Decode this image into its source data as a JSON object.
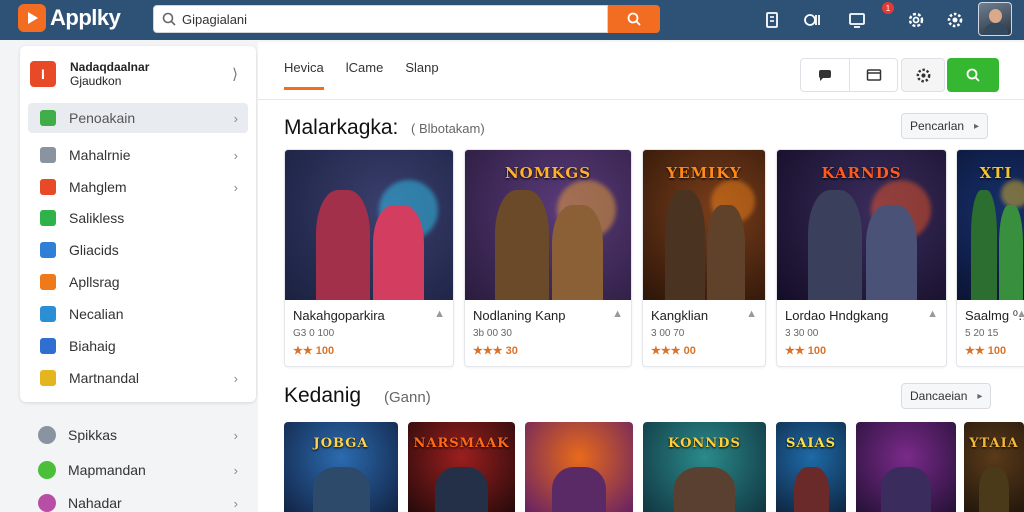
{
  "app": {
    "name": "Applky"
  },
  "search": {
    "value": "Gipagialani",
    "placeholder": ""
  },
  "header": {
    "notif_count": "1"
  },
  "sidebar": {
    "header": {
      "line1": "Nadaqdaalnar",
      "line2": "Gjaudkon",
      "icon_letter": "I"
    },
    "items": [
      {
        "label": "Penoakain",
        "icon_color": "#3fae49"
      },
      {
        "label": "Mahalrnie",
        "icon_color": "#8a94a0"
      },
      {
        "label": "Mahglem",
        "icon_color": "#e84a27"
      },
      {
        "label": "Salikless",
        "icon_color": "#2fb24a"
      },
      {
        "label": "Gliacids",
        "icon_color": "#2f7fd6"
      },
      {
        "label": "Apllsrag",
        "icon_color": "#f07a1a"
      },
      {
        "label": "Necalian",
        "icon_color": "#2b8fd6"
      },
      {
        "label": "Biahaig",
        "icon_color": "#2f6fd0"
      },
      {
        "label": "Martnandal",
        "icon_color": "#e3b61f"
      }
    ],
    "items2": [
      {
        "label": "Spikkas",
        "icon_color": "#8a94a0"
      },
      {
        "label": "Mapmandan",
        "icon_color": "#4cbf3a"
      },
      {
        "label": "Nahadar",
        "icon_color": "#b84fa7"
      }
    ]
  },
  "tabs": [
    {
      "label": "Hevica"
    },
    {
      "label": "lCame"
    },
    {
      "label": "Slanp"
    }
  ],
  "section1": {
    "title": "Malarkagka:",
    "subtitle": "( Blbotakam)",
    "button": "Pencarlan"
  },
  "section2": {
    "title": "Kedanig",
    "subtitle": "(Gann)",
    "button": "Dancaeian"
  },
  "cards": [
    {
      "name": "Nakahgoparkira",
      "meta": "G3 0 100",
      "price": "★★ 100",
      "banner": "",
      "bg1": "#3b3f6e",
      "bg2": "#1a2140",
      "accent": "#2fd7ff",
      "fig": "#a2304a"
    },
    {
      "name": "Nodlaning Kanp",
      "meta": "3b 00 30",
      "price": "★★★ 30",
      "banner": "NOMKGS",
      "bg1": "#5a3b7a",
      "bg2": "#2a1c3d",
      "accent": "#ffb02e",
      "fig": "#6b4a2a"
    },
    {
      "name": "Kangklian",
      "meta": "3 00 70",
      "price": "★★★ 00",
      "banner": "YEMIKY",
      "bg1": "#7a3e1b",
      "bg2": "#2c1508",
      "accent": "#ff8a1a",
      "fig": "#4a3320"
    },
    {
      "name": "Lordao Hndgkang",
      "meta": "3 30 00",
      "price": "★★ 100",
      "banner": "KARNDS",
      "bg1": "#3b2d5e",
      "bg2": "#140d26",
      "accent": "#ff5a1f",
      "fig": "#3a3f5c"
    },
    {
      "name": "Saalmg ⁰…",
      "meta": "5 20 15",
      "price": "★★ 100",
      "banner": "XTI",
      "bg1": "#16306b",
      "bg2": "#0b1434",
      "accent": "#f5c425",
      "fig": "#2b6e2f"
    }
  ],
  "cards2": [
    {
      "banner": "JOBGA",
      "bg1": "#2b6bb0",
      "bg2": "#101d3b",
      "accent": "#ffd34a",
      "fig": "#2d4a6b"
    },
    {
      "banner": "NARSMAAK",
      "bg1": "#9b1f1f",
      "bg2": "#1a0808",
      "accent": "#ff6a1a",
      "fig": "#243048"
    },
    {
      "banner": "",
      "bg1": "#e86a1a",
      "bg2": "#5a1a6b",
      "accent": "#ffd54a",
      "fig": "#5a2a66"
    },
    {
      "banner": "KONNDS",
      "bg1": "#2a8a8a",
      "bg2": "#0f2f3b",
      "accent": "#ffcf3a",
      "fig": "#5a4030"
    },
    {
      "banner": "SAIAS",
      "bg1": "#1e6aa8",
      "bg2": "#0c1d33",
      "accent": "#ffe04a",
      "fig": "#6b2a2a"
    },
    {
      "banner": "",
      "bg1": "#7a2a8a",
      "bg2": "#1c0f2e",
      "accent": "#ff7a2a",
      "fig": "#3a2c5c"
    },
    {
      "banner": "YTAIA",
      "bg1": "#5a3a1a",
      "bg2": "#1a120a",
      "accent": "#f2b83a",
      "fig": "#4a3a1a"
    }
  ],
  "colors": {
    "brand": "#f26d21",
    "header": "#2e5276",
    "green": "#35b732"
  }
}
